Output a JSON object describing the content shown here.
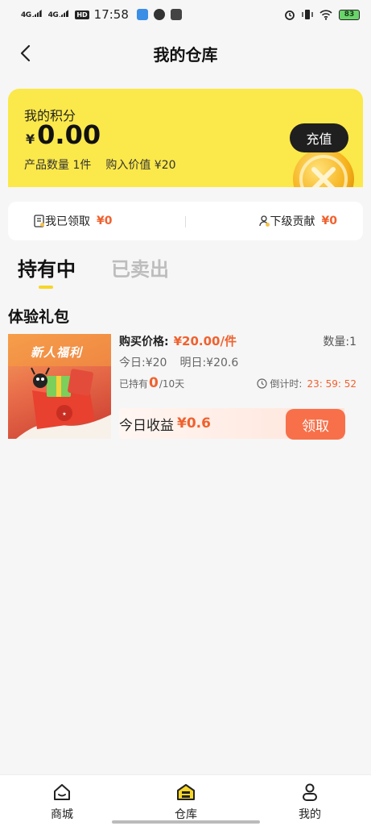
{
  "status_bar": {
    "signal1": "4G",
    "signal2": "4G",
    "hd": "HD",
    "time": "17:58",
    "battery": "83"
  },
  "nav": {
    "title": "我的仓库"
  },
  "points": {
    "label": "我的积分",
    "currency": "¥",
    "value": "0.00",
    "product_count": "产品数量 1件",
    "purchase_value": "购入价值 ¥20",
    "recharge": "充值"
  },
  "summary": {
    "received_label": "我已领取",
    "received_amount": "¥0",
    "contrib_label": "下级贡献",
    "contrib_amount": "¥0"
  },
  "tabs": [
    {
      "label": "持有中",
      "active": true
    },
    {
      "label": "已卖出",
      "active": false
    }
  ],
  "section": {
    "title": "体验礼包"
  },
  "product": {
    "image_text": "新人福利",
    "price_label": "购买价格:",
    "price_value": "¥20.00/件",
    "qty": "数量:1",
    "today": "今日:¥20",
    "tomorrow": "明日:¥20.6",
    "hold_prefix": "已持有",
    "hold_days": "0",
    "hold_suffix": "/10天",
    "countdown_label": "倒计时:",
    "countdown_value": "23: 59: 52",
    "earn_label": "今日收益",
    "earn_value": "¥0.6",
    "claim": "领取"
  },
  "bottom_nav": [
    {
      "label": "商城",
      "icon": "home-icon"
    },
    {
      "label": "仓库",
      "icon": "warehouse-icon",
      "active": true
    },
    {
      "label": "我的",
      "icon": "user-icon"
    }
  ],
  "colors": {
    "accent_yellow": "#fbe84a",
    "accent_orange": "#f0612e",
    "button_dark": "#1f1f1f"
  }
}
